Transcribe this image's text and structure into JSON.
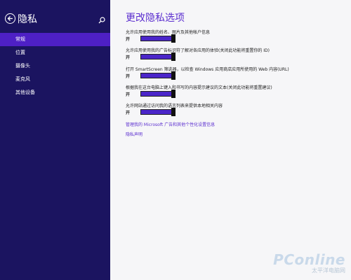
{
  "sidebar": {
    "title": "隐私",
    "items": [
      {
        "label": "常规"
      },
      {
        "label": "位置"
      },
      {
        "label": "摄像头"
      },
      {
        "label": "麦克风"
      },
      {
        "label": "其他设备"
      }
    ]
  },
  "main": {
    "heading": "更改隐私选项",
    "options": [
      {
        "label": "允许应用使用我的姓名、图片及其他帐户信息",
        "state": "开",
        "on": true
      },
      {
        "label": "允许应用使用我的广告标识符了解对各应用的体验(关闭此功能将重置你的 ID)",
        "state": "开",
        "on": true
      },
      {
        "label": "打开 SmartScreen 筛选器，以检查 Windows 应用商店应用所使用的 Web 内容(URL)",
        "state": "开",
        "on": true
      },
      {
        "label": "根据我在这台电脑上键入和书写的内容提示建议的文本(关闭此功能将重置建议)",
        "state": "开",
        "on": true
      },
      {
        "label": "允许网站通过访问我的语言列表来提供本地相关内容",
        "state": "开",
        "on": true
      }
    ],
    "links": [
      "管理我的 Microsoft 广告和其他个性化设置信息",
      "隐私声明"
    ]
  },
  "watermark": {
    "main": "PConline",
    "sub": "太平洋电脑网"
  },
  "colors": {
    "sidebar_bg": "#1b1460",
    "active_item": "#4e20c5",
    "accent": "#5b2ecf",
    "toggle_fill": "#4b26c9"
  }
}
